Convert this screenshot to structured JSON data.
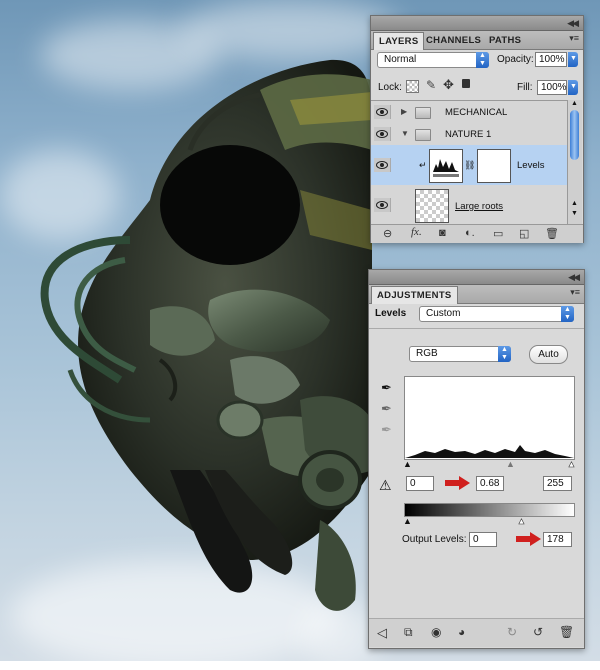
{
  "layers_panel": {
    "tabs": [
      "LAYERS",
      "CHANNELS",
      "PATHS"
    ],
    "blend_mode": "Normal",
    "opacity_label": "Opacity:",
    "opacity_value": "100%",
    "lock_label": "Lock:",
    "fill_label": "Fill:",
    "fill_value": "100%",
    "layers": [
      {
        "name": "MECHANICAL",
        "type": "group"
      },
      {
        "name": "NATURE 1",
        "type": "group"
      },
      {
        "name": "Levels",
        "type": "adjustment"
      },
      {
        "name": "Large roots",
        "type": "layer"
      }
    ]
  },
  "adjustments_panel": {
    "tab": "ADJUSTMENTS",
    "preset_label": "Levels",
    "preset_value": "Custom",
    "channel_value": "RGB",
    "auto_button": "Auto",
    "input_black": "0",
    "input_gamma": "0.68",
    "input_white": "255",
    "output_label": "Output Levels:",
    "output_black": "0",
    "output_white": "178"
  },
  "colors": {
    "accent_red": "#d0201e",
    "selection_blue": "#b6d2f2"
  }
}
